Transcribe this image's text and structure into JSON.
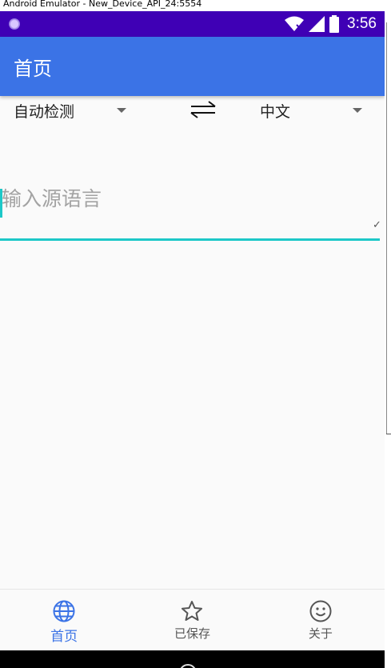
{
  "window": {
    "title": "Android Emulator - New_Device_API_24:5554"
  },
  "status_bar": {
    "time": "3:56",
    "background": "#3f00b5"
  },
  "app_bar": {
    "title": "首页",
    "background": "#3b73e6"
  },
  "language_bar": {
    "source_language": "自动检测",
    "target_language": "中文"
  },
  "source_input": {
    "placeholder": "输入源语言",
    "value": ""
  },
  "bottom_nav": {
    "items": [
      {
        "label": "首页",
        "icon": "globe-icon",
        "active": true
      },
      {
        "label": "已保存",
        "icon": "star-icon",
        "active": false
      },
      {
        "label": "关于",
        "icon": "smiley-icon",
        "active": false
      }
    ],
    "active_color": "#3b73e6"
  },
  "accent_color": "#1dc8c8"
}
